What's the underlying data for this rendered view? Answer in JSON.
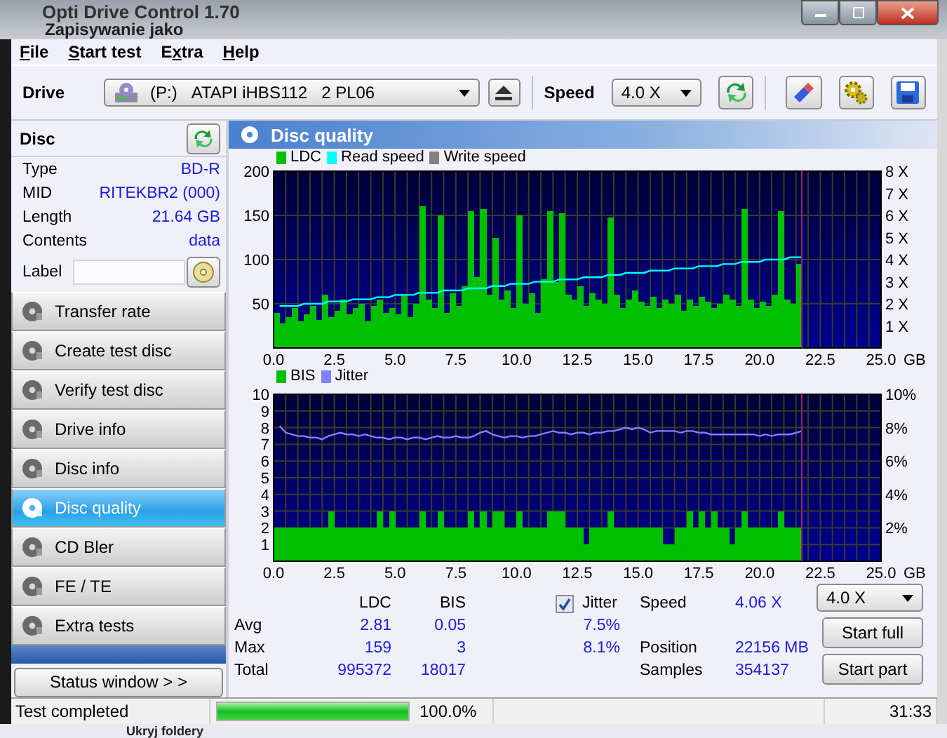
{
  "window": {
    "title": "Opti Drive Control 1.70"
  },
  "behind_dialog": {
    "title": "Zapisywanie jako"
  },
  "behind_sidebar": {
    "item": "Ukryj foldery"
  },
  "menu": [
    {
      "key": "F",
      "post": "ile"
    },
    {
      "key": "S",
      "post": "tart test"
    },
    {
      "pre": "E",
      "key": "x",
      "post": "tra"
    },
    {
      "key": "H",
      "post": "elp"
    }
  ],
  "toolbar": {
    "drive_label": "Drive",
    "drive_letter": "(P:)",
    "drive_name": "ATAPI iHBS112   2 PL06",
    "speed_label": "Speed",
    "speed_value": "4.0 X"
  },
  "disc": {
    "title": "Disc",
    "rows": [
      {
        "label": "Type",
        "value": "BD-R"
      },
      {
        "label": "MID",
        "value": "RITEKBR2 (000)"
      },
      {
        "label": "Length",
        "value": "21.64 GB"
      },
      {
        "label": "Contents",
        "value": "data"
      }
    ],
    "label_field": {
      "label": "Label"
    }
  },
  "nav": [
    {
      "label": "Transfer rate",
      "selected": false
    },
    {
      "label": "Create test disc",
      "selected": false
    },
    {
      "label": "Verify test disc",
      "selected": false
    },
    {
      "label": "Drive info",
      "selected": false
    },
    {
      "label": "Disc info",
      "selected": false
    },
    {
      "label": "Disc quality",
      "selected": true
    },
    {
      "label": "CD Bler",
      "selected": false
    },
    {
      "label": "FE / TE",
      "selected": false
    },
    {
      "label": "Extra tests",
      "selected": false
    }
  ],
  "status_button": "Status window > >",
  "panel": {
    "title": "Disc quality"
  },
  "ldc_chart": {
    "extra_legend": [
      {
        "label": "Write speed",
        "color": "#808080"
      }
    ],
    "chart_data": {
      "type": "bar",
      "grid": true,
      "xlabel": "GB",
      "xlim": [
        0,
        25
      ],
      "ylim": [
        0,
        200
      ],
      "y2lim": [
        0,
        8
      ],
      "xticks": [
        {
          "value": 0,
          "label": "0.0"
        },
        {
          "value": 2.5,
          "label": "2.5"
        },
        {
          "value": 5,
          "label": "5.0"
        },
        {
          "value": 7.5,
          "label": "7.5"
        },
        {
          "value": 10,
          "label": "10.0"
        },
        {
          "value": 12.5,
          "label": "12.5"
        },
        {
          "value": 15,
          "label": "15.0"
        },
        {
          "value": 17.5,
          "label": "17.5"
        },
        {
          "value": 20,
          "label": "20.0"
        },
        {
          "value": 22.5,
          "label": "22.5"
        },
        {
          "value": 25,
          "label": "25.0"
        }
      ],
      "yticks": [
        50,
        100,
        150,
        200
      ],
      "y2ticks": [
        {
          "value": 1,
          "label": "1 X"
        },
        {
          "value": 2,
          "label": "2 X"
        },
        {
          "value": 3,
          "label": "3 X"
        },
        {
          "value": 4,
          "label": "4 X"
        },
        {
          "value": 5,
          "label": "5 X"
        },
        {
          "value": 6,
          "label": "6 X"
        },
        {
          "value": 7,
          "label": "7 X"
        },
        {
          "value": 8,
          "label": "8 X"
        }
      ],
      "x": [
        0.25,
        0.5,
        0.75,
        1,
        1.25,
        1.5,
        1.75,
        2,
        2.25,
        2.5,
        2.75,
        3,
        3.25,
        3.5,
        3.75,
        4,
        4.25,
        4.5,
        4.75,
        5,
        5.25,
        5.5,
        5.75,
        6,
        6.25,
        6.5,
        6.75,
        7,
        7.25,
        7.5,
        7.75,
        8,
        8.25,
        8.5,
        8.75,
        9,
        9.25,
        9.5,
        9.75,
        10,
        10.25,
        10.5,
        10.75,
        11,
        11.25,
        11.5,
        11.75,
        12,
        12.25,
        12.5,
        12.75,
        13,
        13.25,
        13.5,
        13.75,
        14,
        14.25,
        14.5,
        14.75,
        15,
        15.25,
        15.5,
        15.75,
        16,
        16.25,
        16.5,
        16.75,
        17,
        17.25,
        17.5,
        17.75,
        18,
        18.25,
        18.5,
        18.75,
        19,
        19.25,
        19.5,
        19.75,
        20,
        20.25,
        20.5,
        20.75,
        21,
        21.25,
        21.5,
        21.75
      ],
      "series": [
        {
          "name": "LDC",
          "color": "#00c000",
          "values": [
            40,
            28,
            35,
            45,
            30,
            38,
            48,
            32,
            60,
            35,
            42,
            55,
            38,
            45,
            50,
            30,
            48,
            55,
            40,
            45,
            38,
            60,
            35,
            50,
            160,
            55,
            45,
            150,
            40,
            62,
            48,
            70,
            155,
            80,
            157,
            60,
            125,
            55,
            65,
            45,
            150,
            50,
            62,
            40,
            78,
            155,
            75,
            152,
            60,
            55,
            70,
            48,
            62,
            55,
            50,
            148,
            60,
            45,
            55,
            65,
            52,
            48,
            58,
            45,
            55,
            50,
            60,
            42,
            55,
            48,
            58,
            52,
            45,
            50,
            60,
            55,
            48,
            157,
            55,
            45,
            52,
            48,
            60,
            155,
            55,
            50,
            95
          ]
        },
        {
          "name": "Read speed",
          "color": "#00ffff",
          "type": "line",
          "axis": "y2",
          "values": [
            1.9,
            1.9,
            1.9,
            1.9,
            2.0,
            2.0,
            2.0,
            2.0,
            2.1,
            2.1,
            2.1,
            2.1,
            2.2,
            2.2,
            2.2,
            2.2,
            2.3,
            2.3,
            2.3,
            2.4,
            2.4,
            2.4,
            2.4,
            2.5,
            2.5,
            2.5,
            2.5,
            2.6,
            2.6,
            2.6,
            2.6,
            2.7,
            2.7,
            2.7,
            2.7,
            2.8,
            2.8,
            2.8,
            2.9,
            2.9,
            2.9,
            2.9,
            3.0,
            3.0,
            3.0,
            3.0,
            3.1,
            3.1,
            3.1,
            3.1,
            3.2,
            3.2,
            3.2,
            3.2,
            3.3,
            3.3,
            3.3,
            3.4,
            3.4,
            3.4,
            3.4,
            3.5,
            3.5,
            3.5,
            3.5,
            3.6,
            3.6,
            3.6,
            3.6,
            3.7,
            3.7,
            3.7,
            3.7,
            3.8,
            3.8,
            3.8,
            3.9,
            3.9,
            3.9,
            3.9,
            4.0,
            4.0,
            4.0,
            4.0,
            4.1,
            4.1,
            4.1
          ]
        }
      ]
    }
  },
  "bis_chart": {
    "chart_data": {
      "type": "bar",
      "grid": true,
      "xlabel": "GB",
      "xlim": [
        0,
        25
      ],
      "ylim": [
        0,
        10
      ],
      "y2lim": [
        0,
        10
      ],
      "xticks": [
        {
          "value": 0,
          "label": "0.0"
        },
        {
          "value": 2.5,
          "label": "2.5"
        },
        {
          "value": 5,
          "label": "5.0"
        },
        {
          "value": 7.5,
          "label": "7.5"
        },
        {
          "value": 10,
          "label": "10.0"
        },
        {
          "value": 12.5,
          "label": "12.5"
        },
        {
          "value": 15,
          "label": "15.0"
        },
        {
          "value": 17.5,
          "label": "17.5"
        },
        {
          "value": 20,
          "label": "20.0"
        },
        {
          "value": 22.5,
          "label": "22.5"
        },
        {
          "value": 25,
          "label": "25.0"
        }
      ],
      "yticks": [
        1,
        2,
        3,
        4,
        5,
        6,
        7,
        8,
        9,
        10
      ],
      "y2ticks": [
        {
          "value": 2,
          "label": "2%"
        },
        {
          "value": 4,
          "label": "4%"
        },
        {
          "value": 6,
          "label": "6%"
        },
        {
          "value": 8,
          "label": "8%"
        },
        {
          "value": 10,
          "label": "10%"
        }
      ],
      "x": [
        0.25,
        0.5,
        0.75,
        1,
        1.25,
        1.5,
        1.75,
        2,
        2.25,
        2.5,
        2.75,
        3,
        3.25,
        3.5,
        3.75,
        4,
        4.25,
        4.5,
        4.75,
        5,
        5.25,
        5.5,
        5.75,
        6,
        6.25,
        6.5,
        6.75,
        7,
        7.25,
        7.5,
        7.75,
        8,
        8.25,
        8.5,
        8.75,
        9,
        9.25,
        9.5,
        9.75,
        10,
        10.25,
        10.5,
        10.75,
        11,
        11.25,
        11.5,
        11.75,
        12,
        12.25,
        12.5,
        12.75,
        13,
        13.25,
        13.5,
        13.75,
        14,
        14.25,
        14.5,
        14.75,
        15,
        15.25,
        15.5,
        15.75,
        16,
        16.25,
        16.5,
        16.75,
        17,
        17.25,
        17.5,
        17.75,
        18,
        18.25,
        18.5,
        18.75,
        19,
        19.25,
        19.5,
        19.75,
        20,
        20.25,
        20.5,
        20.75,
        21,
        21.25,
        21.5,
        21.75
      ],
      "series": [
        {
          "name": "BIS",
          "color": "#00c000",
          "values": [
            2,
            2,
            2,
            2,
            2,
            2,
            2,
            2,
            2,
            3,
            2,
            2,
            2,
            2,
            2,
            2,
            2,
            3,
            2,
            3,
            2,
            2,
            2,
            2,
            3,
            2,
            2,
            3,
            2,
            2,
            2,
            2,
            3,
            2,
            3,
            2,
            3,
            3,
            2,
            2,
            3,
            2,
            2,
            2,
            2,
            3,
            3,
            3,
            2,
            2,
            2,
            1,
            2,
            2,
            2,
            3,
            2,
            2,
            2,
            2,
            2,
            2,
            2,
            2,
            1,
            1,
            2,
            2,
            3,
            2,
            3,
            2,
            3,
            2,
            2,
            1,
            2,
            3,
            2,
            2,
            2,
            2,
            2,
            3,
            2,
            2,
            2
          ]
        },
        {
          "name": "Jitter",
          "color": "#8080ff",
          "type": "line",
          "values": [
            8.1,
            7.7,
            7.6,
            7.5,
            7.5,
            7.4,
            7.4,
            7.3,
            7.5,
            7.6,
            7.7,
            7.6,
            7.6,
            7.5,
            7.6,
            7.5,
            7.4,
            7.4,
            7.3,
            7.4,
            7.4,
            7.3,
            7.4,
            7.4,
            7.3,
            7.4,
            7.5,
            7.4,
            7.4,
            7.5,
            7.4,
            7.4,
            7.5,
            7.7,
            7.8,
            7.6,
            7.5,
            7.4,
            7.5,
            7.5,
            7.4,
            7.5,
            7.5,
            7.6,
            7.7,
            7.8,
            7.7,
            7.7,
            7.6,
            7.7,
            7.7,
            7.6,
            7.7,
            7.7,
            7.8,
            7.8,
            7.9,
            8.0,
            7.9,
            8.0,
            7.9,
            7.7,
            7.8,
            7.8,
            7.8,
            7.8,
            7.7,
            7.8,
            7.8,
            7.7,
            7.7,
            7.6,
            7.6,
            7.6,
            7.6,
            7.6,
            7.6,
            7.6,
            7.6,
            7.5,
            7.6,
            7.5,
            7.6,
            7.6,
            7.6,
            7.7,
            7.8
          ]
        }
      ]
    }
  },
  "stats": {
    "headers": [
      "LDC",
      "BIS"
    ],
    "rows": [
      {
        "label": "Avg",
        "ldc": "2.81",
        "bis": "0.05",
        "jitter": "7.5%"
      },
      {
        "label": "Max",
        "ldc": "159",
        "bis": "3",
        "jitter": "8.1%"
      },
      {
        "label": "Total",
        "ldc": "995372",
        "bis": "18017"
      }
    ],
    "jitter_toggle": {
      "label": "Jitter",
      "checked": true
    }
  },
  "info": [
    {
      "label": "Speed",
      "value": "4.06 X"
    },
    {
      "label": "Position",
      "value": "22156 MB"
    },
    {
      "label": "Samples",
      "value": "354137"
    }
  ],
  "speed_select": "4.0 X",
  "buttons": [
    "Start full",
    "Start part"
  ],
  "status_bar": {
    "message": "Test completed",
    "progress": {
      "level": 1.0
    },
    "percent": "100.0%",
    "time": "31:33"
  }
}
